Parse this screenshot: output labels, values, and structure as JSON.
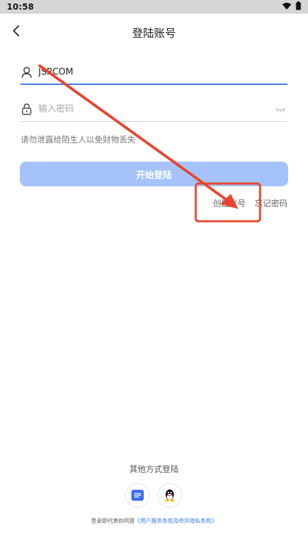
{
  "status_bar": {
    "time": "10:58"
  },
  "header": {
    "title": "登陆账号"
  },
  "form": {
    "account_value": "JSRCOM",
    "password_placeholder": "输入密码",
    "hint": "请勿泄露给陌生人以免财物丢失",
    "login_button": "开始登陆"
  },
  "links": {
    "create_account": "创建账号",
    "forgot_password": "忘记密码"
  },
  "other_login": {
    "title": "其他方式登陆",
    "methods": [
      "message-icon",
      "qq-icon"
    ]
  },
  "terms": {
    "prefix": "登录即代表你同意",
    "link": "《用户服务条款及奇异隐私条款》"
  },
  "colors": {
    "accent": "#3a7bf2",
    "login_button": "#a5c3fa",
    "annotation": "#e8452f"
  }
}
